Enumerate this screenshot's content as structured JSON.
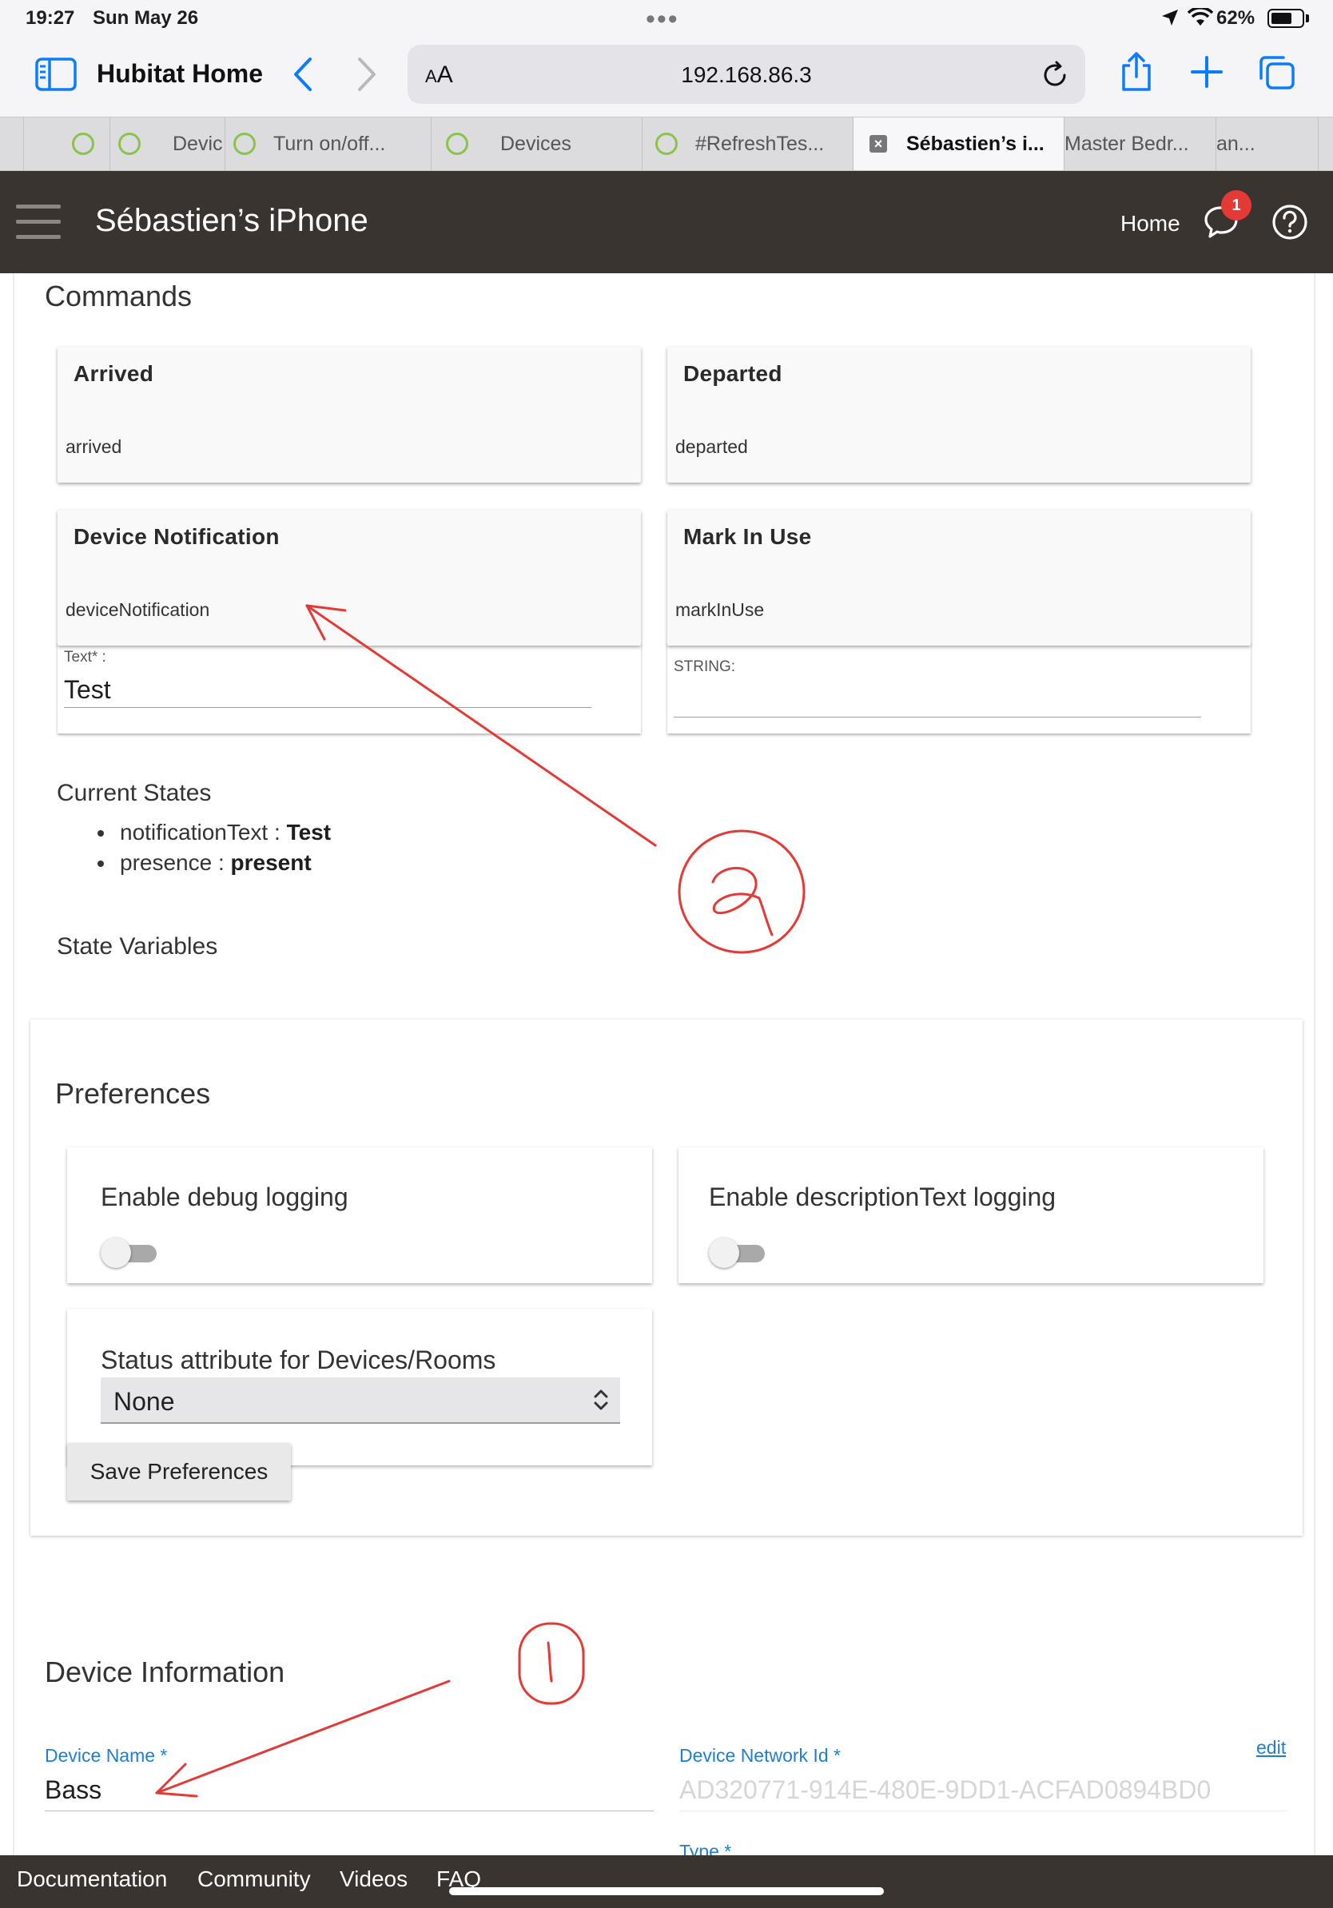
{
  "status_bar": {
    "time": "19:27",
    "date": "Sun May 26",
    "battery_percent": "62%",
    "battery_level": 0.62
  },
  "safari": {
    "window_title": "Hubitat Home",
    "url_size_label_small": "A",
    "url_size_label_large": "A",
    "url": "192.168.86.3",
    "accent_color": "#0a7cff",
    "icons": [
      "sidebar-icon",
      "back-icon",
      "forward-icon",
      "reload-icon",
      "share-icon",
      "plus-icon",
      "tabs-icon"
    ],
    "tabs": [
      {
        "label": ""
      },
      {
        "label": "Devic"
      },
      {
        "label": "Turn on/off..."
      },
      {
        "label": "Devices"
      },
      {
        "label": "#RefreshTes..."
      },
      {
        "label": "Sébastien’s i...",
        "active": true
      },
      {
        "label": "Master Bedr..."
      },
      {
        "label": "an..."
      }
    ]
  },
  "app_bar": {
    "title": "Sébastien’s iPhone",
    "home_label": "Home",
    "notification_count": "1",
    "background_color": "#3a3430"
  },
  "commands": {
    "section_title": "Commands",
    "cards": [
      {
        "title": "Arrived",
        "command": "arrived"
      },
      {
        "title": "Departed",
        "command": "departed"
      },
      {
        "title": "Device Notification",
        "command": "deviceNotification",
        "param_label": "Text* :",
        "param_value": "Test"
      },
      {
        "title": "Mark In Use",
        "command": "markInUse",
        "param_label": "STRING:",
        "param_value": ""
      }
    ]
  },
  "current_states": {
    "title": "Current States",
    "items": [
      {
        "name": "notificationText",
        "separator": " : ",
        "value": "Test"
      },
      {
        "name": "presence",
        "separator": " : ",
        "value": "present"
      }
    ]
  },
  "state_variables": {
    "title": "State Variables"
  },
  "preferences": {
    "title": "Preferences",
    "debug_logging": {
      "label": "Enable debug logging",
      "enabled": false
    },
    "description_logging": {
      "label": "Enable descriptionText logging",
      "enabled": false
    },
    "status_attribute": {
      "label": "Status attribute for Devices/Rooms",
      "value": "None"
    },
    "save_label": "Save Preferences"
  },
  "device_info": {
    "title": "Device Information",
    "device_name_label": "Device Name *",
    "device_name_value": "Bass",
    "network_id_label": "Device Network Id *",
    "network_id_value": "AD320771-914E-480E-9DD1-ACFAD0894BD0",
    "edit_label": "edit",
    "type_label": "Type *",
    "label_color": "#1f7fcf"
  },
  "footer": {
    "links": [
      "Documentation",
      "Community",
      "Videos",
      "FAQ"
    ]
  },
  "annotations": {
    "marker_1": "1",
    "marker_2": "2",
    "ink_color": "#e53935"
  }
}
